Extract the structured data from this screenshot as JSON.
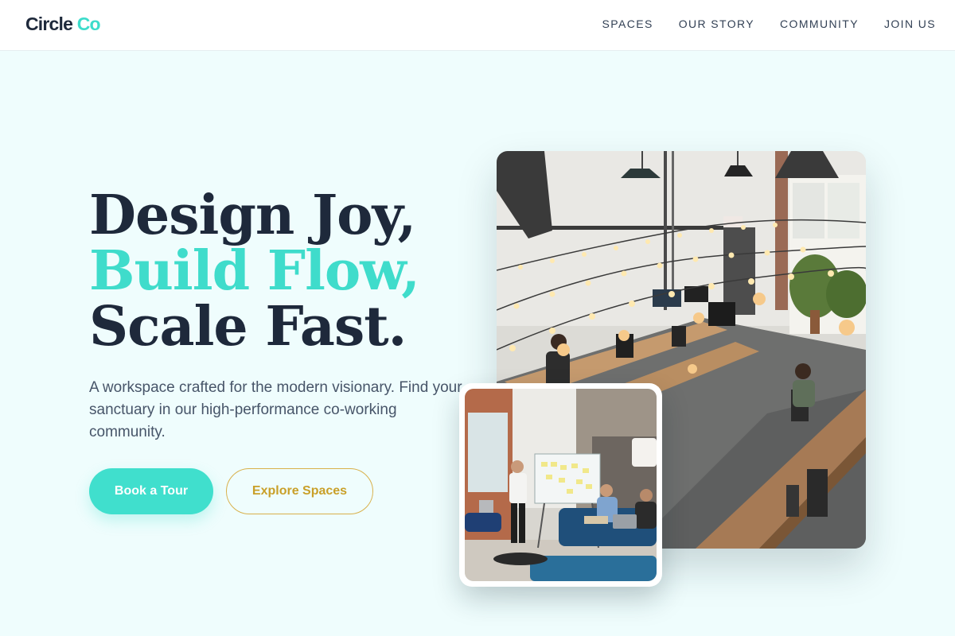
{
  "brand": {
    "name_part1": "Circle",
    "name_part2": "Co",
    "accent_color": "#3ddccb"
  },
  "nav": {
    "items": [
      {
        "label": "SPACES"
      },
      {
        "label": "OUR STORY"
      },
      {
        "label": "COMMUNITY"
      },
      {
        "label": "JOIN US"
      }
    ]
  },
  "hero": {
    "headline_line1": "Design Joy,",
    "headline_line2": "Build Flow,",
    "headline_line3": "Scale Fast.",
    "description": "A workspace crafted for the modern visionary. Find your sanctuary in our high-performance co-working community.",
    "primary_button": "Book a Tour",
    "secondary_button": "Explore Spaces"
  },
  "colors": {
    "background": "#effdfd",
    "headline": "#1e293b",
    "teal": "#40dfcd",
    "gold": "#c9a029"
  },
  "images": {
    "main_photo": "coworking-open-office-photo",
    "small_photo": "team-meeting-whiteboard-photo"
  }
}
